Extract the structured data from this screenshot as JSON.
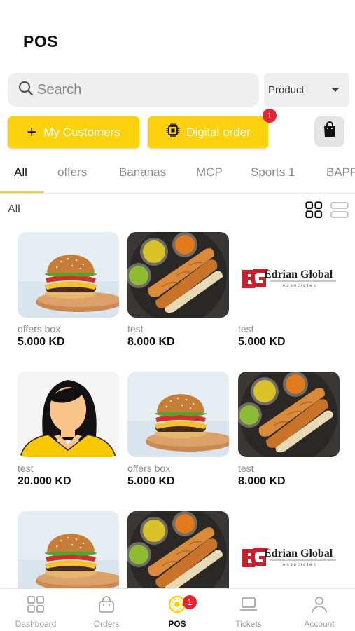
{
  "header": {
    "title": "POS"
  },
  "search": {
    "placeholder": "Search"
  },
  "filter": {
    "selected": "Product"
  },
  "actions": {
    "customers_label": "My Customers",
    "digital_order_label": "Digital order",
    "digital_order_badge": "1"
  },
  "tabs": [
    {
      "label": "All",
      "active": true
    },
    {
      "label": "offers"
    },
    {
      "label": "Bananas"
    },
    {
      "label": "MCP"
    },
    {
      "label": "Sports 1"
    },
    {
      "label": "BAPP"
    }
  ],
  "section": {
    "label": "All"
  },
  "logo_text": {
    "main": "Edrian Global",
    "sub": "Associates"
  },
  "products": [
    {
      "name": "offers box",
      "price": "5.000 KD",
      "image": "burger"
    },
    {
      "name": "test",
      "price": "8.000 KD",
      "image": "dosa"
    },
    {
      "name": "test",
      "price": "5.000 KD",
      "image": "logo"
    },
    {
      "name": "test",
      "price": "20.000 KD",
      "image": "avatar"
    },
    {
      "name": "offers box",
      "price": "5.000 KD",
      "image": "burger"
    },
    {
      "name": "test",
      "price": "8.000 KD",
      "image": "dosa"
    },
    {
      "name": "",
      "price": "",
      "image": "burger"
    },
    {
      "name": "",
      "price": "",
      "image": "dosa"
    },
    {
      "name": "",
      "price": "",
      "image": "logo"
    }
  ],
  "bottom_nav": [
    {
      "label": "Dashboard",
      "icon": "grid-icon"
    },
    {
      "label": "Orders",
      "icon": "bag-icon"
    },
    {
      "label": "POS",
      "icon": "pos-icon",
      "active": true,
      "badge": "1"
    },
    {
      "label": "Tickets",
      "icon": "laptop-icon"
    },
    {
      "label": "Account",
      "icon": "person-icon"
    }
  ],
  "colors": {
    "accent": "#fbd20d",
    "badge": "#e8232f",
    "logo_red": "#c8202c"
  }
}
